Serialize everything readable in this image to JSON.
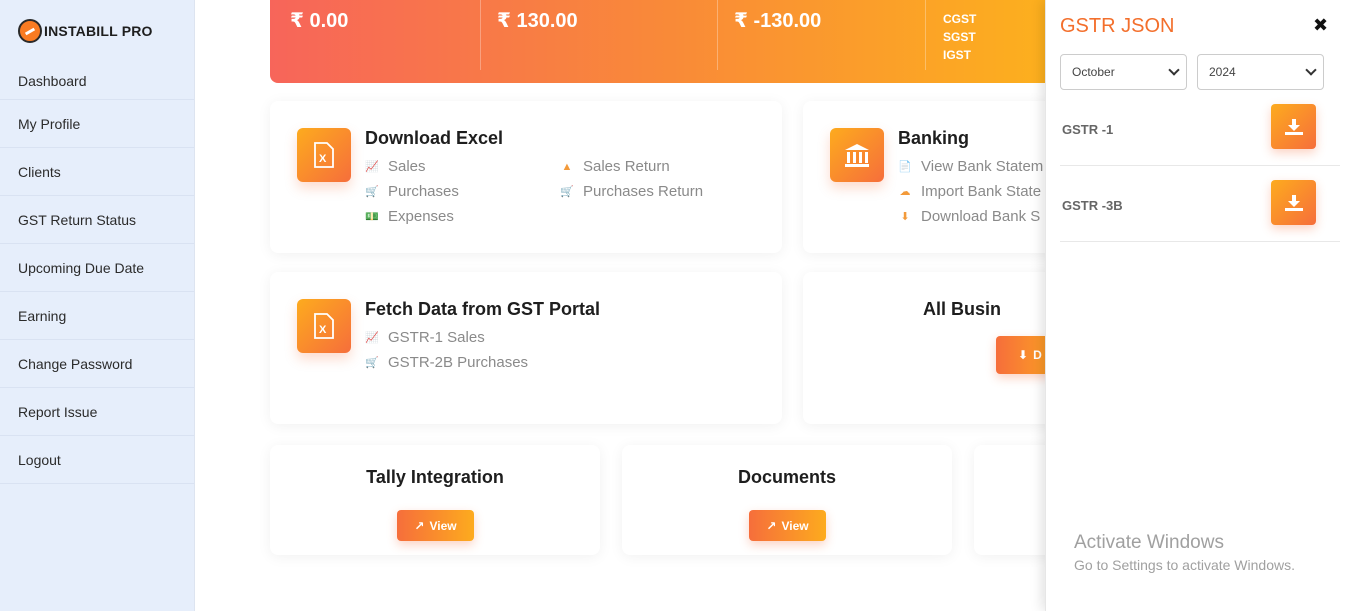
{
  "app": {
    "brand": "INSTABILL PRO"
  },
  "sidebar": {
    "items": [
      {
        "label": "Dashboard"
      },
      {
        "label": "My Profile"
      },
      {
        "label": "Clients"
      },
      {
        "label": "GST Return Status"
      },
      {
        "label": "Upcoming Due Date"
      },
      {
        "label": "Earning"
      },
      {
        "label": "Change Password"
      },
      {
        "label": "Report Issue"
      },
      {
        "label": "Logout"
      }
    ]
  },
  "stats": {
    "s1": "₹ 0.00",
    "s2": "₹ 130.00",
    "s3": "₹ -130.00",
    "taxes": [
      "CGST",
      "SGST",
      "IGST"
    ]
  },
  "cards": {
    "download_excel": {
      "title": "Download Excel",
      "links": [
        "Sales",
        "Purchases",
        "Expenses",
        "Sales Return",
        "Purchases Return"
      ]
    },
    "banking": {
      "title": "Banking",
      "links": [
        "View Bank Statem",
        "Import Bank State",
        "Download Bank S"
      ]
    },
    "fetch": {
      "title": "Fetch Data from GST Portal",
      "links": [
        "GSTR-1 Sales",
        "GSTR-2B Purchases"
      ]
    },
    "all_business": {
      "title": "All Busin",
      "button": "D"
    },
    "tally": {
      "title": "Tally Integration",
      "button": "View"
    },
    "documents": {
      "title": "Documents",
      "button": "View"
    }
  },
  "panel": {
    "title": "GSTR JSON",
    "month": "October",
    "year": "2024",
    "rows": [
      {
        "label": "GSTR -1"
      },
      {
        "label": "GSTR -3B"
      }
    ]
  },
  "watermark": {
    "line1": "Activate Windows",
    "line2": "Go to Settings to activate Windows."
  },
  "colors": {
    "accent": "#f36f2c",
    "gradient_start": "#f7655a",
    "gradient_end": "#fdb21c"
  }
}
